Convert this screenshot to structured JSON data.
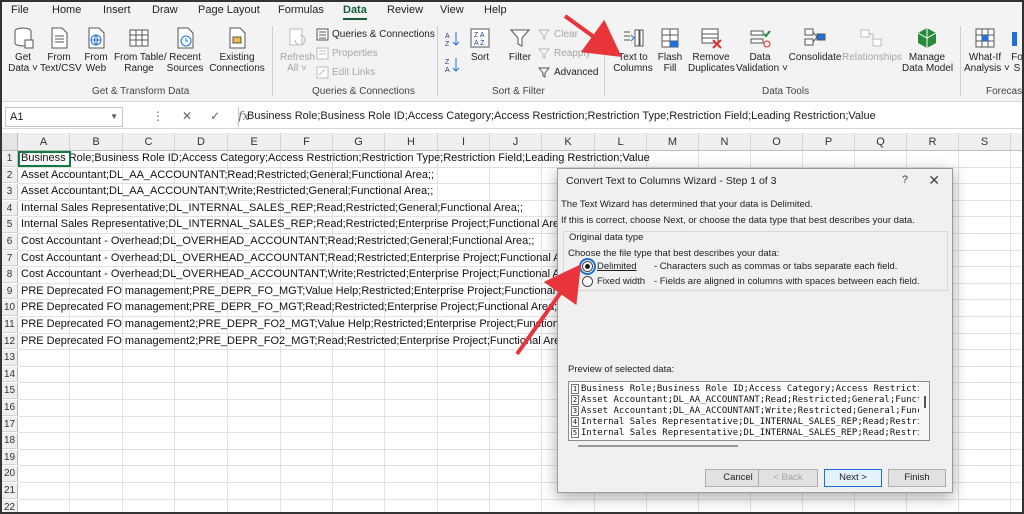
{
  "menu": {
    "tabs": [
      "File",
      "Home",
      "Insert",
      "Draw",
      "Page Layout",
      "Formulas",
      "Data",
      "Review",
      "View",
      "Help"
    ],
    "active": "Data"
  },
  "ribbon": {
    "get_transform": {
      "get_data": "Get\nData ˅",
      "from_text_csv": "From\nText/CSV",
      "from_web": "From\nWeb",
      "from_table_range": "From Table/\nRange",
      "recent_sources": "Recent\nSources",
      "existing_connections": "Existing\nConnections",
      "label": "Get & Transform Data"
    },
    "queries": {
      "refresh_all": "Refresh\nAll ˅",
      "queries_connections": "Queries & Connections",
      "properties": "Properties",
      "edit_links": "Edit Links",
      "label": "Queries & Connections"
    },
    "sort_filter": {
      "sort": "Sort",
      "filter": "Filter",
      "clear": "Clear",
      "reapply": "Reapply",
      "advanced": "Advanced",
      "label": "Sort & Filter"
    },
    "data_tools": {
      "text_to_columns": "Text to\nColumns",
      "flash_fill": "Flash\nFill",
      "remove_duplicates": "Remove\nDuplicates",
      "data_validation": "Data\nValidation ˅",
      "consolidate": "Consolidate",
      "relationships": "Relationships",
      "manage_data_model": "Manage\nData Model",
      "label": "Data Tools"
    },
    "forecast": {
      "what_if": "What-If\nAnalysis ˅",
      "forecast_sheet": "Fo\nS",
      "label": "Forecas"
    }
  },
  "formula_bar": {
    "name_box": "A1",
    "formula": "Business Role;Business Role ID;Access Category;Access Restriction;Restriction Type;Restriction Field;Leading Restriction;Value"
  },
  "sheet": {
    "columns": [
      "A",
      "B",
      "C",
      "D",
      "E",
      "F",
      "G",
      "H",
      "I",
      "J",
      "K",
      "L",
      "M",
      "N",
      "O",
      "P",
      "Q",
      "R",
      "S",
      "T"
    ],
    "rows": [
      "1",
      "2",
      "3",
      "4",
      "5",
      "6",
      "7",
      "8",
      "9",
      "10",
      "11",
      "12",
      "13",
      "14",
      "15",
      "16",
      "17",
      "18",
      "19",
      "20",
      "21",
      "22"
    ],
    "cells": [
      "Business Role;Business Role ID;Access Category;Access Restriction;Restriction Type;Restriction Field;Leading Restriction;Value",
      "Asset Accountant;DL_AA_ACCOUNTANT;Read;Restricted;General;Functional Area;;",
      "Asset Accountant;DL_AA_ACCOUNTANT;Write;Restricted;General;Functional Area;;",
      "Internal Sales Representative;DL_INTERNAL_SALES_REP;Read;Restricted;General;Functional Area;;",
      "Internal Sales Representative;DL_INTERNAL_SALES_REP;Read;Restricted;Enterprise Project;Functional Area;;",
      "Cost Accountant - Overhead;DL_OVERHEAD_ACCOUNTANT;Read;Restricted;General;Functional Area;;",
      "Cost Accountant - Overhead;DL_OVERHEAD_ACCOUNTANT;Read;Restricted;Enterprise Project;Functional Area;;",
      "Cost Accountant - Overhead;DL_OVERHEAD_ACCOUNTANT;Write;Restricted;Enterprise Project;Functional Area;;",
      "PRE Deprecated FO management;PRE_DEPR_FO_MGT;Value Help;Restricted;Enterprise Project;Functional Area;;",
      "PRE Deprecated FO management;PRE_DEPR_FO_MGT;Read;Restricted;Enterprise Project;Functional Area;;",
      "PRE Deprecated FO management2;PRE_DEPR_FO2_MGT;Value Help;Restricted;Enterprise Project;Functional Area;;",
      "PRE Deprecated FO management2;PRE_DEPR_FO2_MGT;Read;Restricted;Enterprise Project;Functional Area;;"
    ]
  },
  "dialog": {
    "title": "Convert Text to Columns Wizard - Step 1 of 3",
    "help": "?",
    "close": "✕",
    "intro1": "The Text Wizard has determined that your data is Delimited.",
    "intro2": "If this is correct, choose Next, or choose the data type that best describes your data.",
    "group_legend": "Original data type",
    "choose_label": "Choose the file type that best describes your data:",
    "delimited_label": "Delimited",
    "delimited_desc": "- Characters such as commas or tabs separate each field.",
    "fixed_label": "Fixed width",
    "fixed_desc": "- Fields are aligned in columns with spaces between each field.",
    "preview_label": "Preview of selected data:",
    "preview_rows": [
      {
        "n": "1",
        "text": "Business Role;Business Role ID;Access Category;Access Restricti"
      },
      {
        "n": "2",
        "text": "Asset Accountant;DL_AA_ACCOUNTANT;Read;Restricted;General;Funct"
      },
      {
        "n": "3",
        "text": "Asset Accountant;DL_AA_ACCOUNTANT;Write;Restricted;General;Func"
      },
      {
        "n": "4",
        "text": "Internal Sales Representative;DL_INTERNAL_SALES_REP;Read;Restri"
      },
      {
        "n": "5",
        "text": "Internal Sales Representative;DL_INTERNAL_SALES_REP;Read;Restri"
      }
    ],
    "buttons": {
      "cancel": "Cancel",
      "back": "< Back",
      "next": "Next >",
      "finish": "Finish"
    }
  },
  "colors": {
    "excel_green": "#185c37",
    "annotation_red": "#e8343b"
  }
}
